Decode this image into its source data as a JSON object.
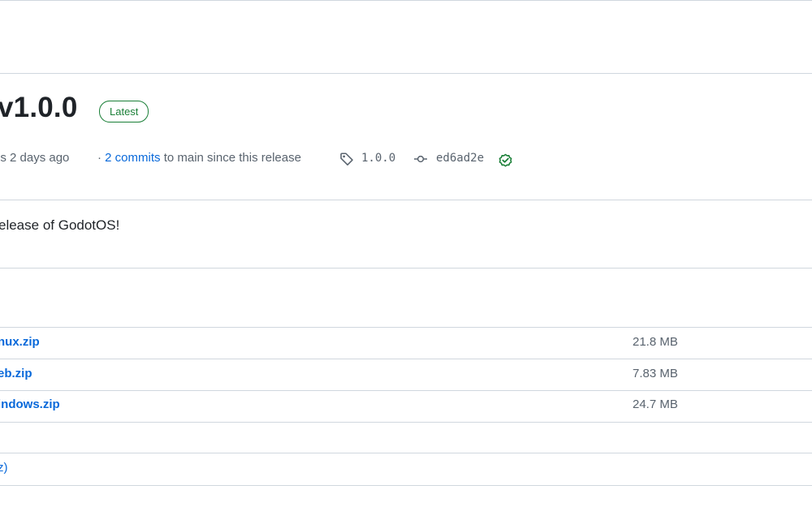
{
  "release": {
    "title": "v1.0.0",
    "badge": "Latest",
    "meta_time": "is 2 days ago",
    "meta_sep": "·",
    "commits_link": "2 commits",
    "commits_suffix": "to main since this release",
    "tag": "1.0.0",
    "commit_hash": "ed6ad2e",
    "description": "elease of GodotOS!"
  },
  "assets": [
    {
      "name": "nux.zip",
      "size": "21.8 MB"
    },
    {
      "name": "eb.zip",
      "size": "7.83 MB"
    },
    {
      "name": "indows.zip",
      "size": "24.7 MB"
    }
  ],
  "source_link": "z)",
  "colors": {
    "link": "#0969da",
    "success": "#1a7f37",
    "muted": "#59636e",
    "border": "#d0d7de"
  },
  "icons": {
    "tag": "tag-icon",
    "commit": "git-commit-icon",
    "verified": "check-circle-icon"
  }
}
